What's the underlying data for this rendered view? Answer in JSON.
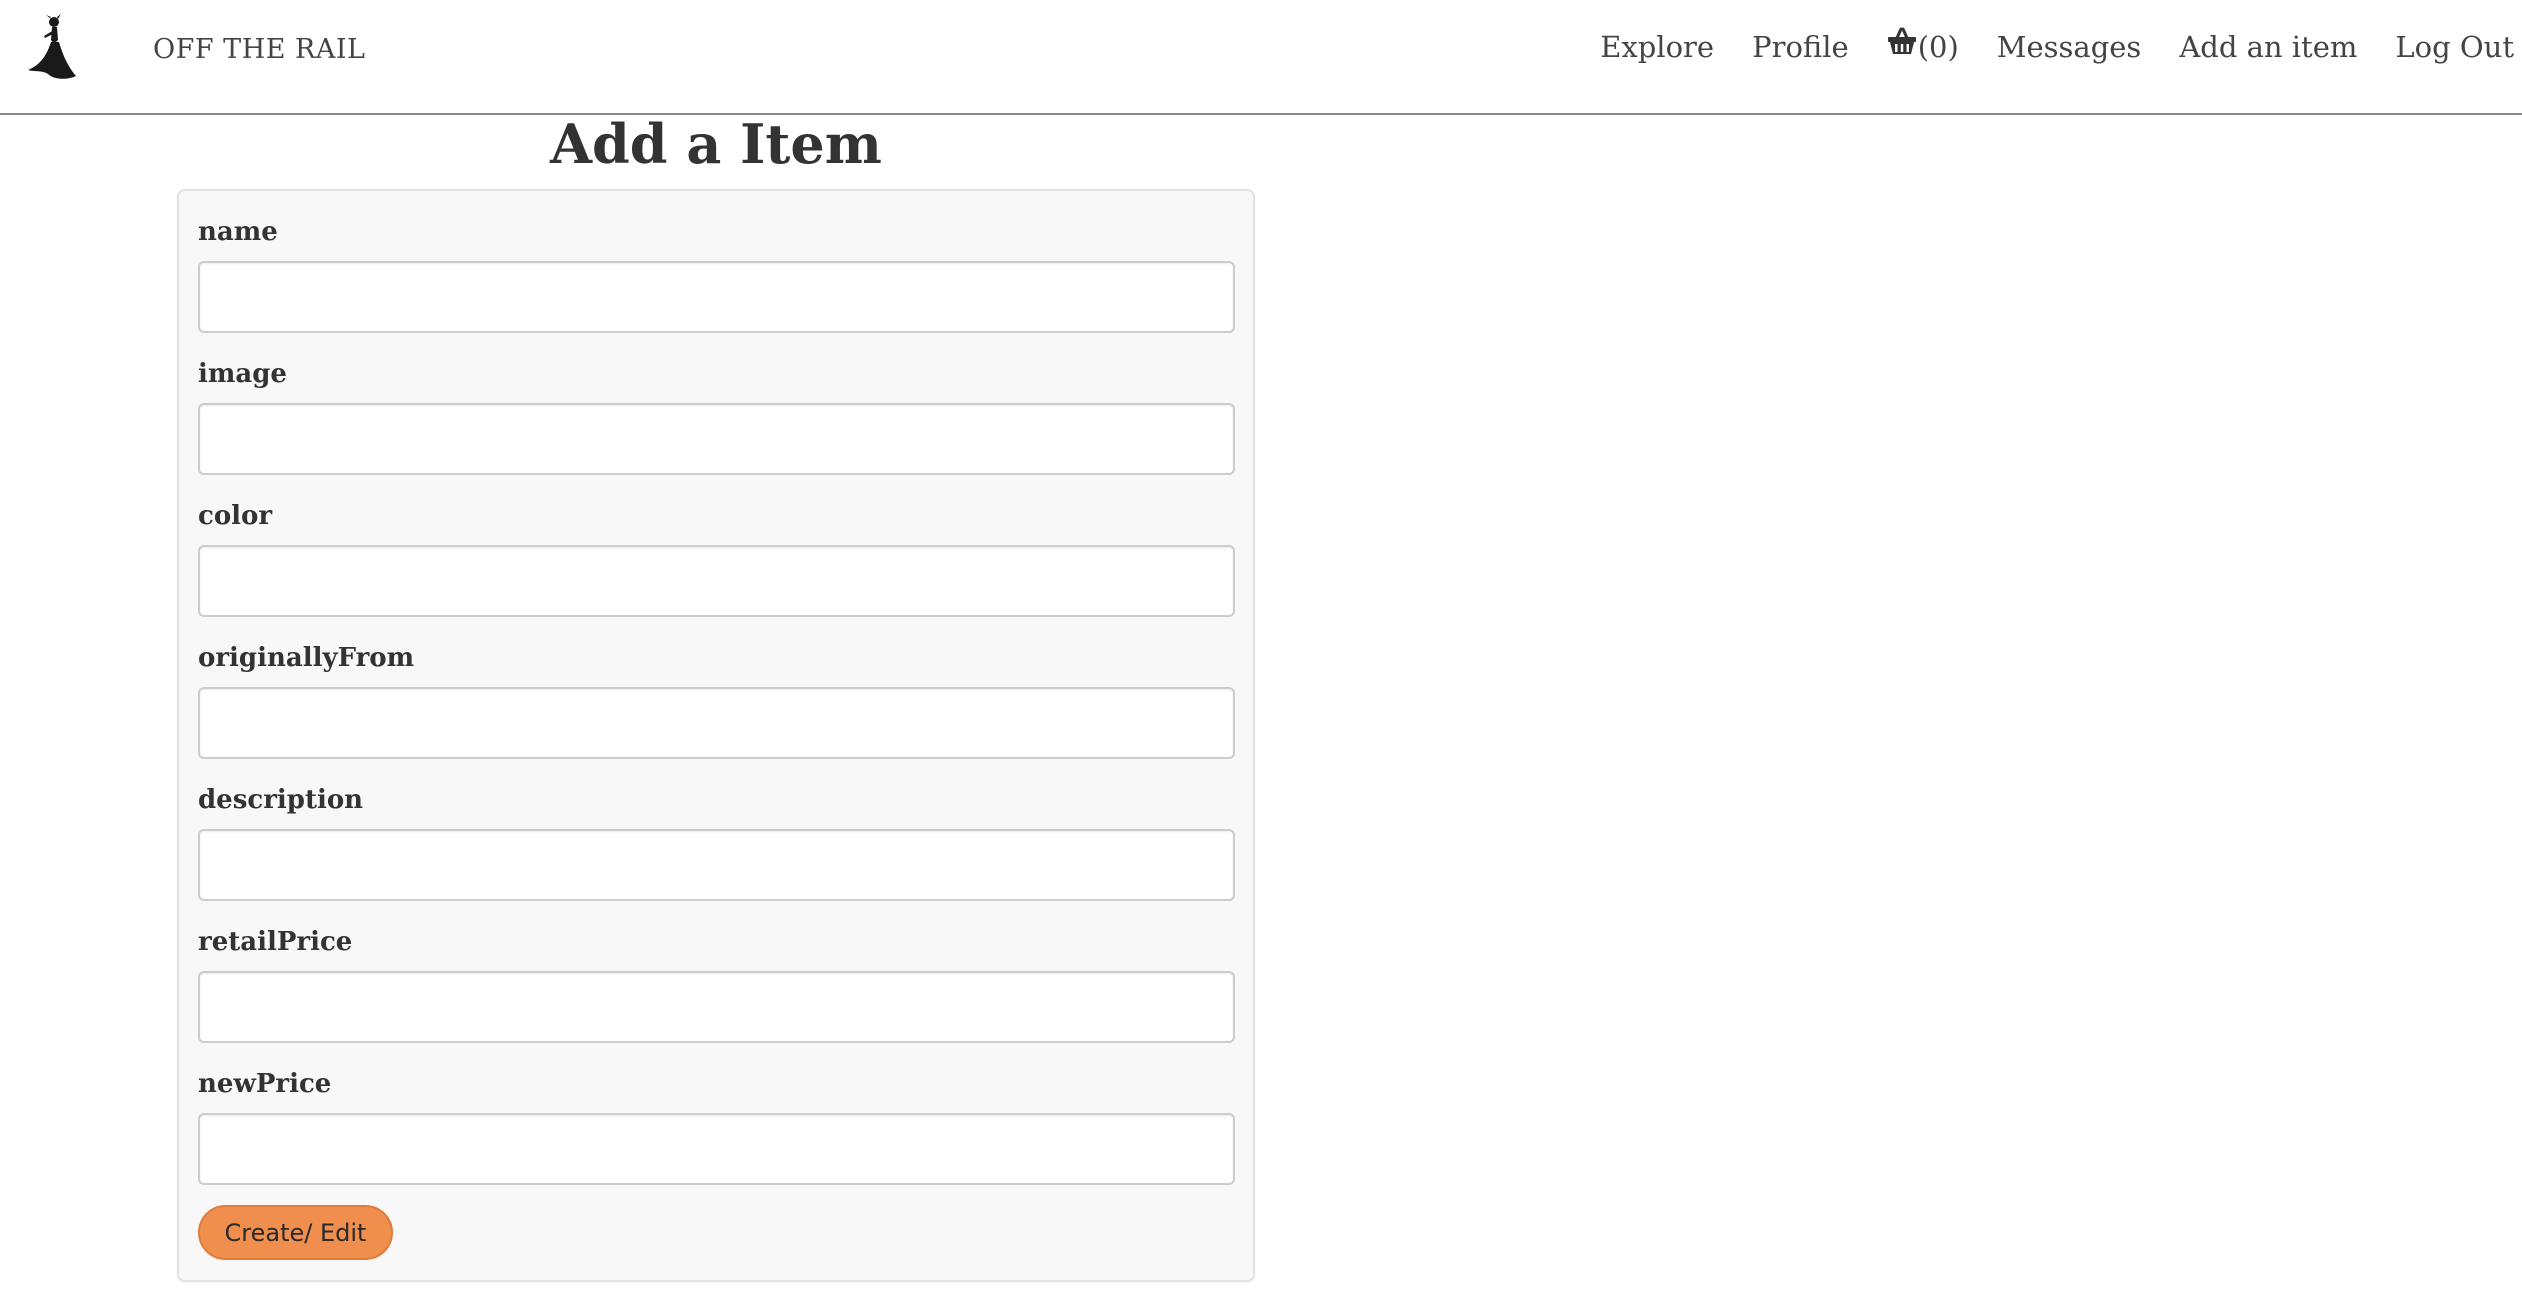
{
  "navbar": {
    "brand": "OFF THE RAIL",
    "logo_icon": "dancer-silhouette-icon",
    "links": {
      "explore": "Explore",
      "profile": "Profile",
      "cart_count": "(0)",
      "cart_icon": "basket-icon",
      "messages": "Messages",
      "add_item": "Add an item",
      "logout": "Log Out"
    }
  },
  "page": {
    "title": "Add a Item"
  },
  "form": {
    "fields": [
      {
        "label": "name",
        "value": "",
        "placeholder": ""
      },
      {
        "label": "image",
        "value": "",
        "placeholder": ""
      },
      {
        "label": "color",
        "value": "",
        "placeholder": ""
      },
      {
        "label": "originallyFrom",
        "value": "",
        "placeholder": ""
      },
      {
        "label": "description",
        "value": "",
        "placeholder": ""
      },
      {
        "label": "retailPrice",
        "value": "",
        "placeholder": ""
      },
      {
        "label": "newPrice",
        "value": "",
        "placeholder": ""
      }
    ],
    "submit_label": "Create/ Edit"
  },
  "colors": {
    "accent": "#ef8e4d",
    "card_background": "#f8f8f8",
    "text": "#333333"
  }
}
